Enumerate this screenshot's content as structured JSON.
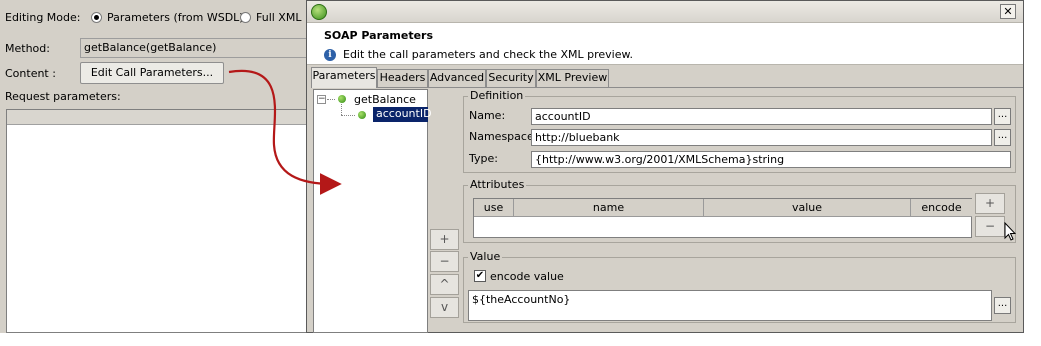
{
  "left": {
    "editing_mode_label": "Editing Mode:",
    "radio_params_label": "Parameters (from WSDL)",
    "radio_fullxml_label": "Full XML",
    "method_label": "Method:",
    "method_value": "getBalance(getBalance)",
    "content_label": "Content :",
    "edit_button_label": "Edit Call Parameters...",
    "request_params_label": "Request parameters:"
  },
  "dialog": {
    "title": "SOAP Parameters",
    "description": "Edit the call parameters and check the XML preview.",
    "close_glyph": "✕",
    "tabs": [
      {
        "label": "Parameters",
        "active": true
      },
      {
        "label": "Headers",
        "active": false
      },
      {
        "label": "Advanced",
        "active": false
      },
      {
        "label": "Security",
        "active": false
      },
      {
        "label": "XML Preview",
        "active": false
      }
    ],
    "tree": {
      "root": "getBalance",
      "child": "accountID"
    },
    "side_buttons": [
      "+",
      "−",
      "^",
      "v"
    ],
    "definition": {
      "group_title": "Definition",
      "name_label": "Name:",
      "name_value": "accountID",
      "namespace_label": "Namespace:",
      "namespace_value": "http://bluebank",
      "type_label": "Type:",
      "type_value": "{http://www.w3.org/2001/XMLSchema}string",
      "browse_glyph": "..."
    },
    "attributes": {
      "group_title": "Attributes",
      "columns": [
        "use",
        "name",
        "value",
        "encode"
      ],
      "add_glyph": "+",
      "remove_glyph": "−"
    },
    "value": {
      "group_title": "Value",
      "encode_label": "encode value",
      "encode_checked": true,
      "value_text": "${theAccountNo}",
      "browse_glyph": "..."
    }
  },
  "colors": {
    "panel_bg": "#d4d0c8",
    "selection": "#0a246a",
    "arrow": "#b41818",
    "node_green": "#3c9a1a"
  }
}
